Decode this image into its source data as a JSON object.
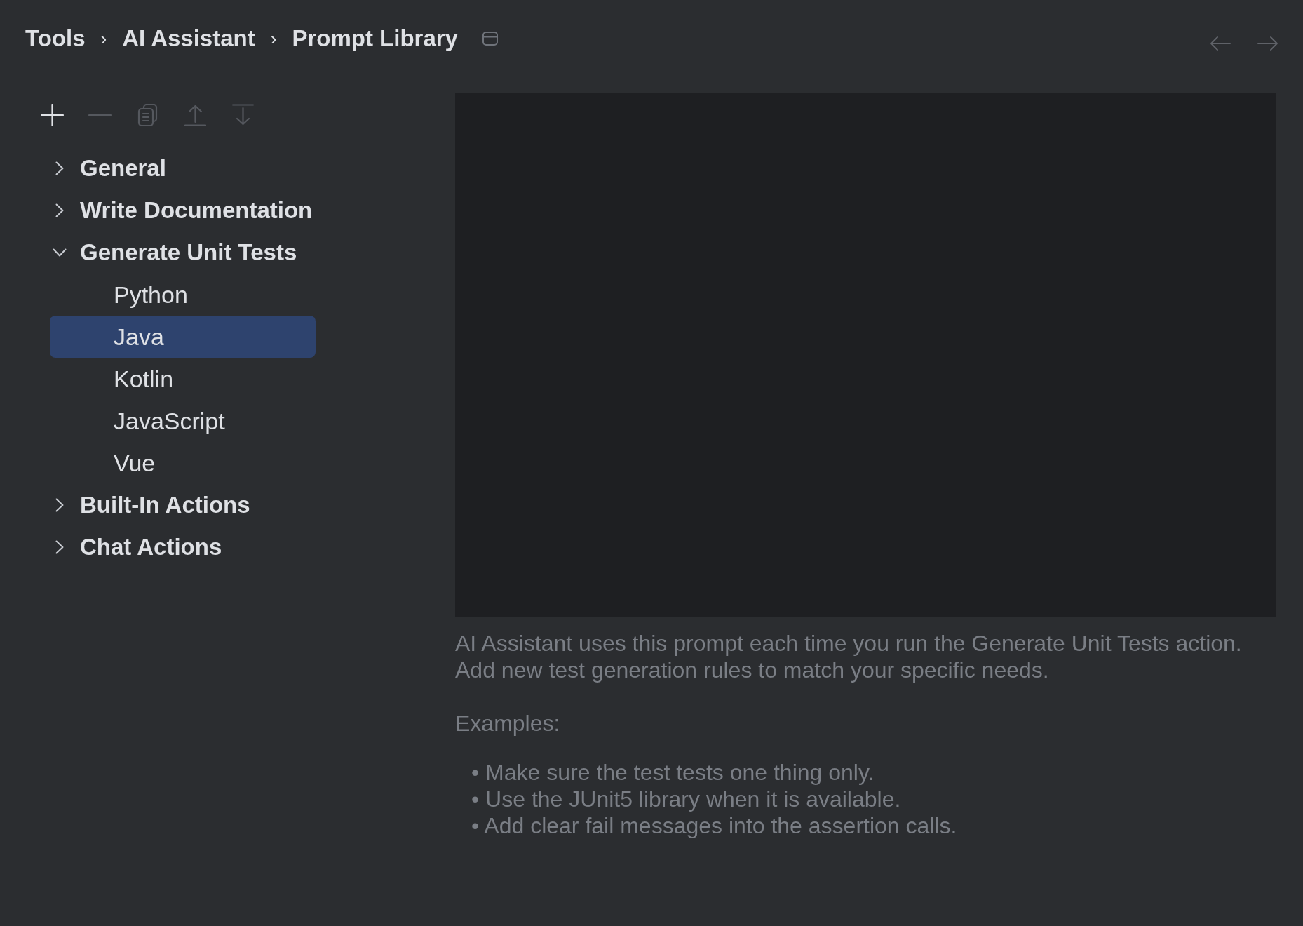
{
  "breadcrumb": [
    {
      "label": "Tools",
      "separator": "›"
    },
    {
      "label": "AI Assistant",
      "separator": "›"
    },
    {
      "label": "Prompt Library"
    }
  ],
  "nav": {
    "back": {
      "disabled": true
    },
    "forward": {
      "disabled": true
    }
  },
  "toolbar": [
    {
      "kind": "add",
      "disabled": false
    },
    {
      "kind": "remove",
      "disabled": true
    },
    {
      "kind": "copy",
      "disabled": true
    },
    {
      "kind": "move_up",
      "disabled": true
    },
    {
      "kind": "move_down",
      "disabled": true
    }
  ],
  "tree": [
    {
      "label": "General",
      "expanded": false,
      "selected": false
    },
    {
      "label": "Write Documentation",
      "expanded": false,
      "selected": false
    },
    {
      "label": "Generate Unit Tests",
      "expanded": true,
      "selected": false,
      "children": [
        {
          "label": "Python",
          "selected": false
        },
        {
          "label": "Java",
          "selected": true
        },
        {
          "label": "Kotlin",
          "selected": false
        },
        {
          "label": "JavaScript",
          "selected": false
        },
        {
          "label": "Vue",
          "selected": false
        }
      ]
    },
    {
      "label": "Built-In Actions",
      "expanded": false,
      "selected": false
    },
    {
      "label": "Chat Actions",
      "expanded": false,
      "selected": false
    }
  ],
  "description": {
    "lines": [
      "AI Assistant uses this prompt each time you run the Generate Unit Tests action.",
      "Add new test generation rules to match your specific needs."
    ],
    "examples_label": "Examples:",
    "examples": [
      "• Make sure the test tests one thing only.",
      "• Use the JUnit5 library when it is available.",
      "• Add clear fail messages into the assertion calls."
    ]
  }
}
